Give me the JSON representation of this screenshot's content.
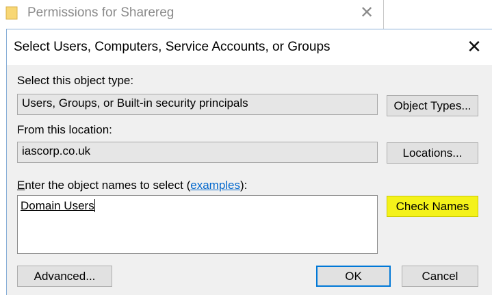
{
  "background_window": {
    "title": "Permissions for Sharereg",
    "close_glyph": "✕"
  },
  "dialog": {
    "title": "Select Users, Computers, Service Accounts, or Groups",
    "close_glyph": "✕",
    "object_type": {
      "label": "Select this object type:",
      "value": "Users, Groups, or Built-in security principals",
      "button": "Object Types..."
    },
    "location": {
      "label": "From this location:",
      "value": "iascorp.co.uk",
      "button": "Locations..."
    },
    "names": {
      "label_mnemonic": "E",
      "label_rest": "nter the object names to select (",
      "link": "examples",
      "label_end": "):",
      "value": "Domain Users",
      "check_button": "Check Names"
    },
    "buttons": {
      "advanced": "Advanced...",
      "ok": "OK",
      "cancel": "Cancel"
    }
  }
}
